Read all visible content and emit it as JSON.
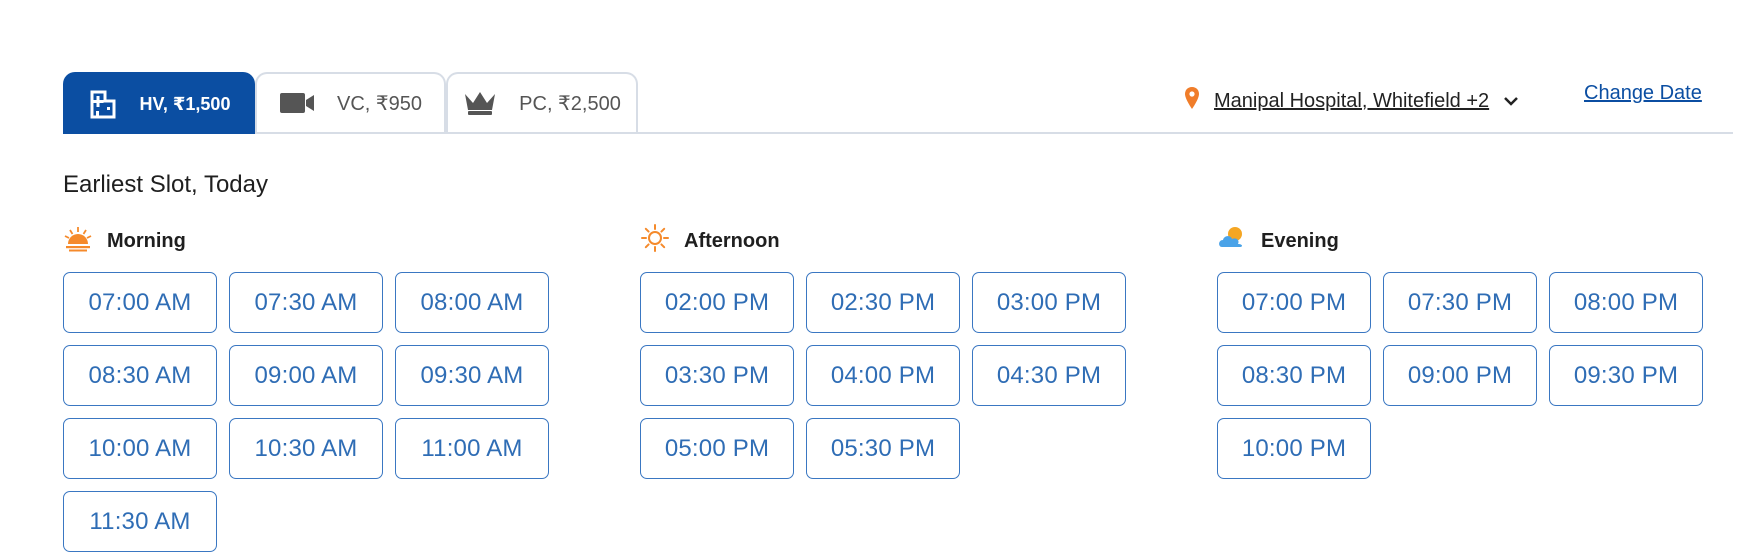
{
  "tabs": [
    {
      "label": "HV, ₹1,500",
      "icon": "hospital-icon",
      "active": true
    },
    {
      "label": "VC, ₹950",
      "icon": "video-camera-icon",
      "active": false
    },
    {
      "label": "PC, ₹2,500",
      "icon": "crown-icon",
      "active": false
    }
  ],
  "location": {
    "label": "Manipal Hospital, Whitefield +2",
    "icon": "location-pin-icon"
  },
  "change_date": "Change Date",
  "earliest_slot": "Earliest Slot, Today",
  "sections": [
    {
      "title": "Morning",
      "icon": "sunrise-icon",
      "slots": [
        "07:00 AM",
        "07:30 AM",
        "08:00 AM",
        "08:30 AM",
        "09:00 AM",
        "09:30 AM",
        "10:00 AM",
        "10:30 AM",
        "11:00 AM",
        "11:30 AM"
      ]
    },
    {
      "title": "Afternoon",
      "icon": "sun-icon",
      "slots": [
        "02:00 PM",
        "02:30 PM",
        "03:00 PM",
        "03:30 PM",
        "04:00 PM",
        "04:30 PM",
        "05:00 PM",
        "05:30 PM"
      ]
    },
    {
      "title": "Evening",
      "icon": "moon-cloud-icon",
      "slots": [
        "07:00 PM",
        "07:30 PM",
        "08:00 PM",
        "08:30 PM",
        "09:00 PM",
        "09:30 PM",
        "10:00 PM"
      ]
    }
  ],
  "colors": {
    "accent": "#0b4ea2",
    "slot_border": "#3a77c2",
    "slot_text": "#2f6db5",
    "pin": "#f07d2a"
  }
}
